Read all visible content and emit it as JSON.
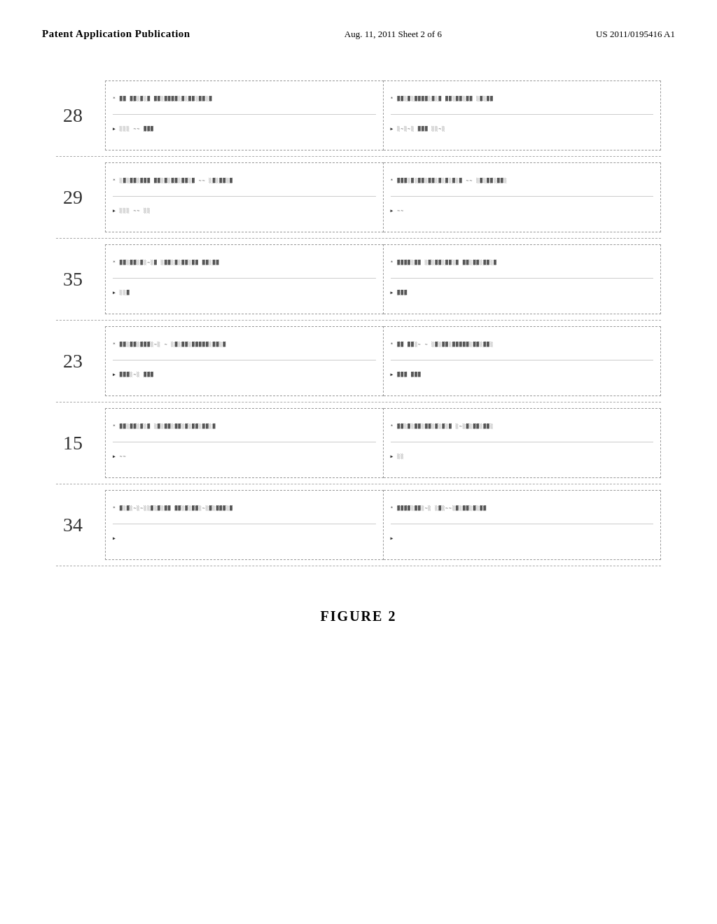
{
  "header": {
    "left": "Patent Application Publication",
    "center": "Aug. 11, 2011   Sheet 2 of 6",
    "right": "US 2011/0195416 A1"
  },
  "rows": [
    {
      "number": "28",
      "panels": [
        {
          "top": "* ▓▓  ▓▓░▓░▓  ▓▓░▓▓▓▓░▓░▓▓░▓▓░▓",
          "bottom": "▶          ░░░  ∼∼      ▓▓▓"
        },
        {
          "top": "* ▓▓░▓░▓▓▓▓░▓░▓  ▓▓░▓▓░▓▓  ░▓░▓▓",
          "bottom": "▶ ░∼░∼░        ▓▓▓        ░░∼░"
        }
      ]
    },
    {
      "number": "29",
      "panels": [
        {
          "top": "* ░▓░▓▓░▓▓▓  ▓▓░▓░▓▓░▓▓░▓  ∼∼ ░▓░▓▓░▓",
          "bottom": "▶ ░░░           ∼∼ ░░"
        },
        {
          "top": "* ▓▓▓░▓░▓▓░▓▓░▓░▓░▓░▓  ∼∼  ░▓░▓▓░▓▓░",
          "bottom": "▶                    ∼∼"
        }
      ]
    },
    {
      "number": "35",
      "panels": [
        {
          "top": "* ▓▓░▓▓░▓░∼░▓  ░▓▓░▓░▓▓░▓▓  ▓▓░▓▓",
          "bottom": "▶        ░░▓"
        },
        {
          "top": "* ▓▓▓▓░▓▓  ░▓░▓▓░▓▓░▓  ▓▓░▓▓░▓▓░▓",
          "bottom": "▶          ▓▓▓"
        }
      ]
    },
    {
      "number": "23",
      "panels": [
        {
          "top": "* ▓▓░▓▓░▓▓▓░∼░  ∼ ░▓░▓▓░▓▓▓▓▓░▓▓░▓",
          "bottom": "▶          ▓▓▓░∼░            ▓▓▓"
        },
        {
          "top": "* ▓▓  ▓▓░∼  ∼ ░▓░▓▓░▓▓▓▓▓░▓▓░▓▓░",
          "bottom": "▶     ▓▓▓       ▓▓▓"
        }
      ]
    },
    {
      "number": "15",
      "panels": [
        {
          "top": "* ▓▓░▓▓░▓░▓  ░▓░▓▓░▓▓░▓░▓▓░▓▓░▓",
          "bottom": "▶                ∼∼"
        },
        {
          "top": "* ▓▓░▓░▓▓░▓▓░▓░▓░▓  ░∼░▓░▓▓░▓▓░",
          "bottom": "▶                  ░░"
        }
      ]
    },
    {
      "number": "34",
      "panels": [
        {
          "top": "* ▓░▓░∼░∼░░▓░▓░▓▓  ▓▓░▓░▓▓░∼░▓░▓▓▓░▓",
          "bottom": "▶"
        },
        {
          "top": "* ▓▓▓▓░▓▓░∼░  ░▓░∼∼░▓░▓▓░▓░▓▓",
          "bottom": "▶"
        }
      ]
    }
  ],
  "figure_caption": "FIGURE 2"
}
